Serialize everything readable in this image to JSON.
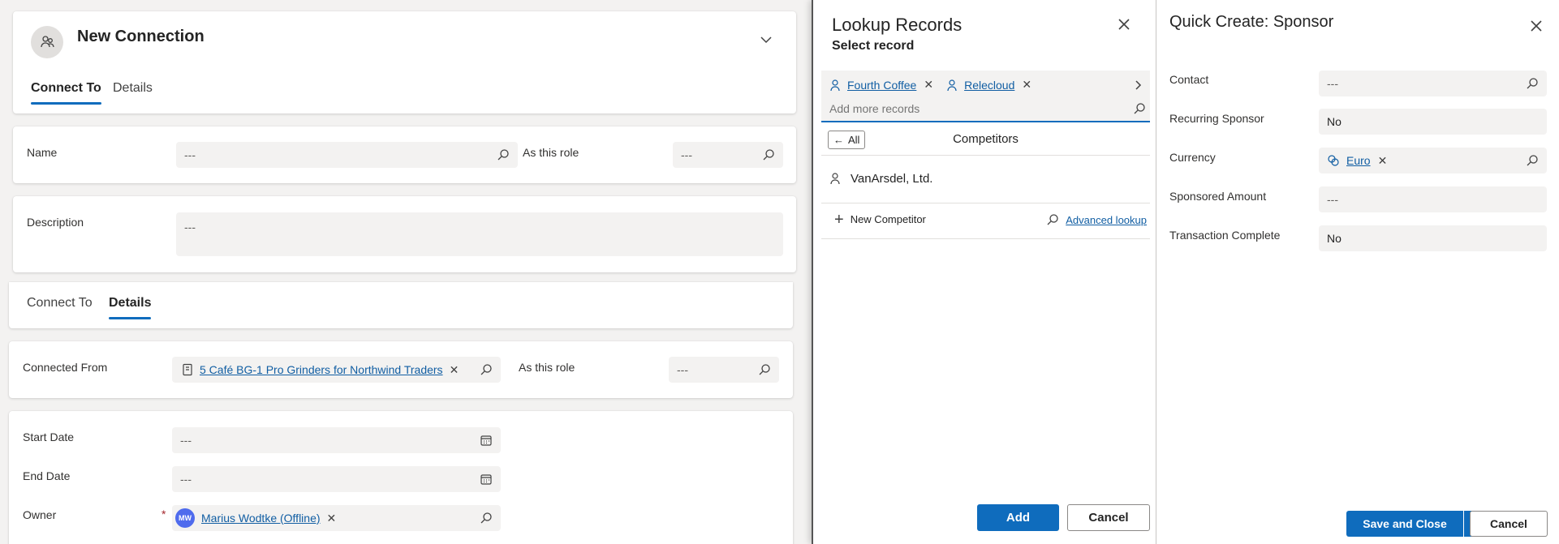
{
  "connection_card": {
    "title": "New Connection",
    "tabs": [
      "Connect To",
      "Details"
    ]
  },
  "connect_to": {
    "name_label": "Name",
    "name_placeholder": "---",
    "role_label": "As this role",
    "role_placeholder": "---",
    "description_label": "Description",
    "description_placeholder": "---"
  },
  "details_section": {
    "tabs": [
      "Connect To",
      "Details"
    ],
    "connected_from_label": "Connected From",
    "connected_from_value": "5 Café BG-1 Pro Grinders for Northwind Traders",
    "role_label": "As this role",
    "role_placeholder": "---",
    "start_date_label": "Start Date",
    "start_date_placeholder": "---",
    "end_date_label": "End Date",
    "end_date_placeholder": "---",
    "owner_label": "Owner",
    "owner_required": "*",
    "owner_initials": "MW",
    "owner_value": "Marius Wodtke (Offline)"
  },
  "lookup": {
    "title": "Lookup Records",
    "subtitle": "Select record",
    "selected": [
      "Fourth Coffee",
      "Relecloud"
    ],
    "search_placeholder": "Add more records",
    "all_button": "All",
    "group_heading": "Competitors",
    "results": [
      "VanArsdel, Ltd."
    ],
    "new_button": "New Competitor",
    "advanced_lookup": "Advanced lookup",
    "add_button": "Add",
    "cancel_button": "Cancel"
  },
  "quick_create": {
    "title": "Quick Create: Sponsor",
    "contact_label": "Contact",
    "contact_placeholder": "---",
    "recurring_label": "Recurring Sponsor",
    "recurring_value": "No",
    "currency_label": "Currency",
    "currency_value": "Euro",
    "amount_label": "Sponsored Amount",
    "amount_placeholder": "---",
    "transaction_label": "Transaction Complete",
    "transaction_value": "No",
    "save_close_button": "Save and Close",
    "cancel_button": "Cancel"
  },
  "colors": {
    "accent": "#0f6cbd",
    "link": "#115ea3",
    "field_bg": "#f3f2f1"
  }
}
